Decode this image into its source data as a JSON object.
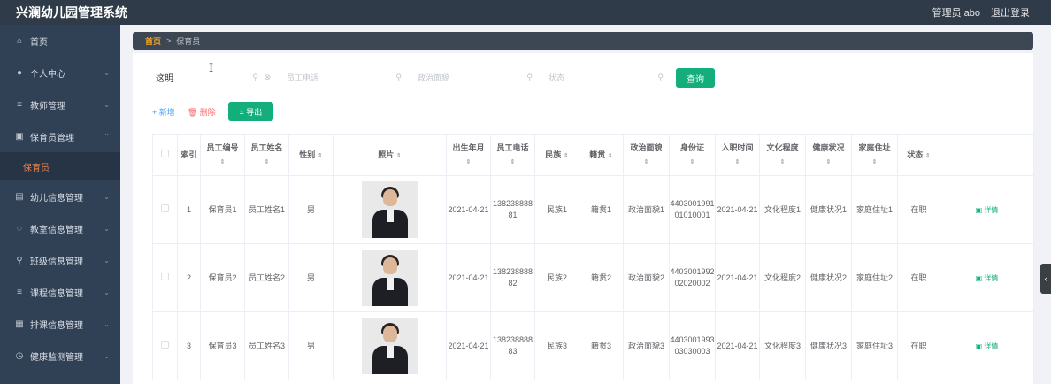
{
  "app": {
    "title": "兴澜幼儿园管理系统",
    "user_label": "管理员 abo",
    "logout_label": "退出登录"
  },
  "sidebar": {
    "items": [
      {
        "label": "首页",
        "icon": "home-icon"
      },
      {
        "label": "个人中心",
        "icon": "user-icon"
      },
      {
        "label": "教师管理",
        "icon": "list-icon"
      },
      {
        "label": "保育员管理",
        "icon": "clipboard-icon"
      },
      {
        "label": "保育员",
        "icon": ""
      },
      {
        "label": "幼儿信息管理",
        "icon": "id-card-icon"
      },
      {
        "label": "教室信息管理",
        "icon": "classroom-icon"
      },
      {
        "label": "班级信息管理",
        "icon": "class-icon"
      },
      {
        "label": "课程信息管理",
        "icon": "list-icon"
      },
      {
        "label": "排课信息管理",
        "icon": "grid-icon"
      },
      {
        "label": "健康监测管理",
        "icon": "clock-icon"
      }
    ]
  },
  "breadcrumb": {
    "home": "首页",
    "separator": ">",
    "current": "保育员"
  },
  "search": {
    "name_value": "这明",
    "phone_placeholder": "员工电话",
    "politics_placeholder": "政治面貌",
    "status_placeholder": "状态",
    "query_label": "查询"
  },
  "actions": {
    "add_label": "+ 新增",
    "delete_label": "删除",
    "export_label": "导出"
  },
  "table": {
    "headers": {
      "index": "索引",
      "emp_no": "员工编号",
      "emp_name": "员工姓名",
      "gender": "性别",
      "photo": "照片",
      "birth": "出生年月",
      "phone": "员工电话",
      "nation": "民族",
      "native": "籍贯",
      "politics": "政治面貌",
      "idcard": "身份证",
      "entry": "入职时间",
      "edu": "文化程度",
      "health": "健康状况",
      "address": "家庭住址",
      "status": "状态"
    },
    "sort_icon": "⇕",
    "rows": [
      {
        "index": "1",
        "emp_no": "保育员1",
        "emp_name": "员工姓名1",
        "gender": "男",
        "birth": "2021-04-21",
        "phone": "13823888881",
        "nation": "民族1",
        "native": "籍贯1",
        "politics": "政治面貌1",
        "idcard": "440300199101010001",
        "entry": "2021-04-21",
        "edu": "文化程度1",
        "health": "健康状况1",
        "address": "家庭住址1",
        "status": "在职",
        "detail": "详情"
      },
      {
        "index": "2",
        "emp_no": "保育员2",
        "emp_name": "员工姓名2",
        "gender": "男",
        "birth": "2021-04-21",
        "phone": "13823888882",
        "nation": "民族2",
        "native": "籍贯2",
        "politics": "政治面貌2",
        "idcard": "440300199202020002",
        "entry": "2021-04-21",
        "edu": "文化程度2",
        "health": "健康状况2",
        "address": "家庭住址2",
        "status": "在职",
        "detail": "详情"
      },
      {
        "index": "3",
        "emp_no": "保育员3",
        "emp_name": "员工姓名3",
        "gender": "男",
        "birth": "2021-04-21",
        "phone": "13823888883",
        "nation": "民族3",
        "native": "籍贯3",
        "politics": "政治面貌3",
        "idcard": "440300199303030003",
        "entry": "2021-04-21",
        "edu": "文化程度3",
        "health": "健康状况3",
        "address": "家庭住址3",
        "status": "在职",
        "detail": "详情"
      }
    ]
  },
  "colors": {
    "accent": "#13ae7c",
    "sidebar": "#304156",
    "topbar": "#2f3b48",
    "active": "#e9824f"
  }
}
